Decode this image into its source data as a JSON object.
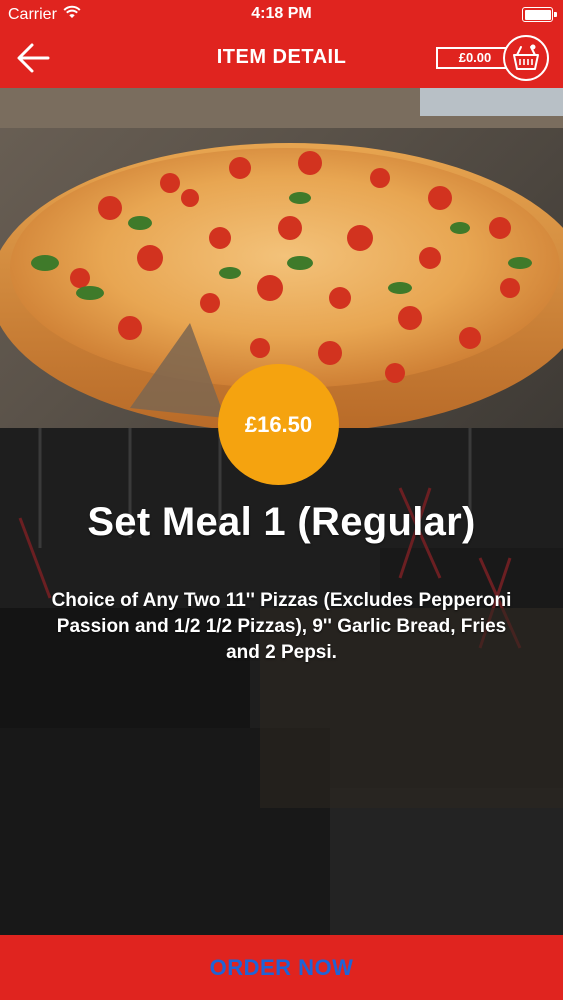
{
  "status_bar": {
    "carrier": "Carrier",
    "time": "4:18 PM",
    "wifi_icon": "wifi-icon",
    "battery_icon": "battery-icon"
  },
  "nav": {
    "title": "ITEM DETAIL",
    "back_icon": "arrow-left-icon",
    "cart_amount": "£0.00",
    "cart_icon": "basket-icon"
  },
  "item": {
    "price": "£16.50",
    "name": "Set Meal 1 (Regular)",
    "description": "Choice of Any Two 11'' Pizzas (Excludes Pepperoni Passion and 1/2 1/2 Pizzas), 9'' Garlic Bread, Fries and 2 Pepsi."
  },
  "order_button": {
    "label": "ORDER NOW"
  },
  "colors": {
    "brand_red": "#e0241f",
    "price_orange": "#f5a30f",
    "order_text_blue": "#1f64d6"
  }
}
